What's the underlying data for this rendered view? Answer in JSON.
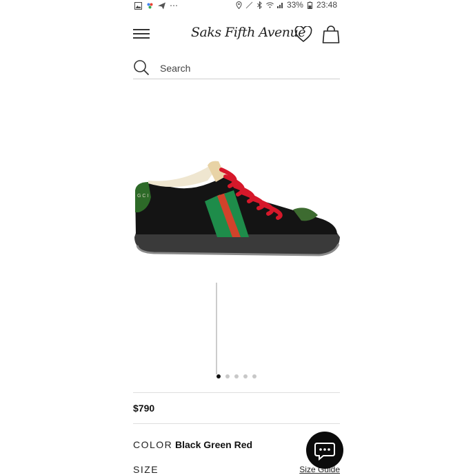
{
  "status_bar": {
    "battery": "33%",
    "time": "23:48",
    "left_icons": [
      "gallery-icon",
      "assistant-icon",
      "send-icon",
      "more-icon"
    ],
    "right_icons": [
      "location-icon",
      "mute-icon",
      "bluetooth-icon",
      "wifi-icon",
      "signal-icon",
      "battery-icon"
    ]
  },
  "header": {
    "logo_text": "Saks Fifth Avenue",
    "menu_icon": "hamburger-icon",
    "wishlist_icon": "heart-icon",
    "bag_icon": "shopping-bag-icon"
  },
  "search": {
    "placeholder": "Search",
    "icon": "search-icon"
  },
  "product": {
    "image_alt": "Black green red sneaker",
    "carousel_pages": 5,
    "carousel_active": 1,
    "price": "$790",
    "color_label": "COLOR",
    "color_value": "Black Green Red",
    "size_label": "SIZE",
    "size_guide_label": "Size Guide"
  },
  "chat": {
    "icon": "chat-bubble-icon"
  },
  "colors": {
    "stripe_green": "#1e8c4a",
    "stripe_red": "#d2432b",
    "laces": "#d6182a",
    "shoe_body": "#141414"
  }
}
